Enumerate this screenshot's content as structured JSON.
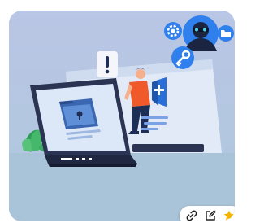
{
  "image": {
    "alt": "",
    "colors": {
      "background": "#b7c9e2",
      "floor": "#a8c2d9",
      "laptop_screen": "#dde8f7",
      "laptop_body": "#2b3453",
      "person_shirt": "#f05a2b",
      "accent_blue": "#2a6fd8",
      "hacker_circle": "#2f80ed"
    },
    "icons": [
      "gear-icon",
      "hacker-avatar",
      "folder-icon",
      "key-icon",
      "alert-icon",
      "shield-icon",
      "lock-file-icon",
      "plant"
    ]
  },
  "actions": [
    {
      "name": "copy-link",
      "icon": "link-icon"
    },
    {
      "name": "edit",
      "icon": "edit-icon"
    },
    {
      "name": "favorite",
      "icon": "star-icon",
      "color": "#f5b400"
    }
  ]
}
